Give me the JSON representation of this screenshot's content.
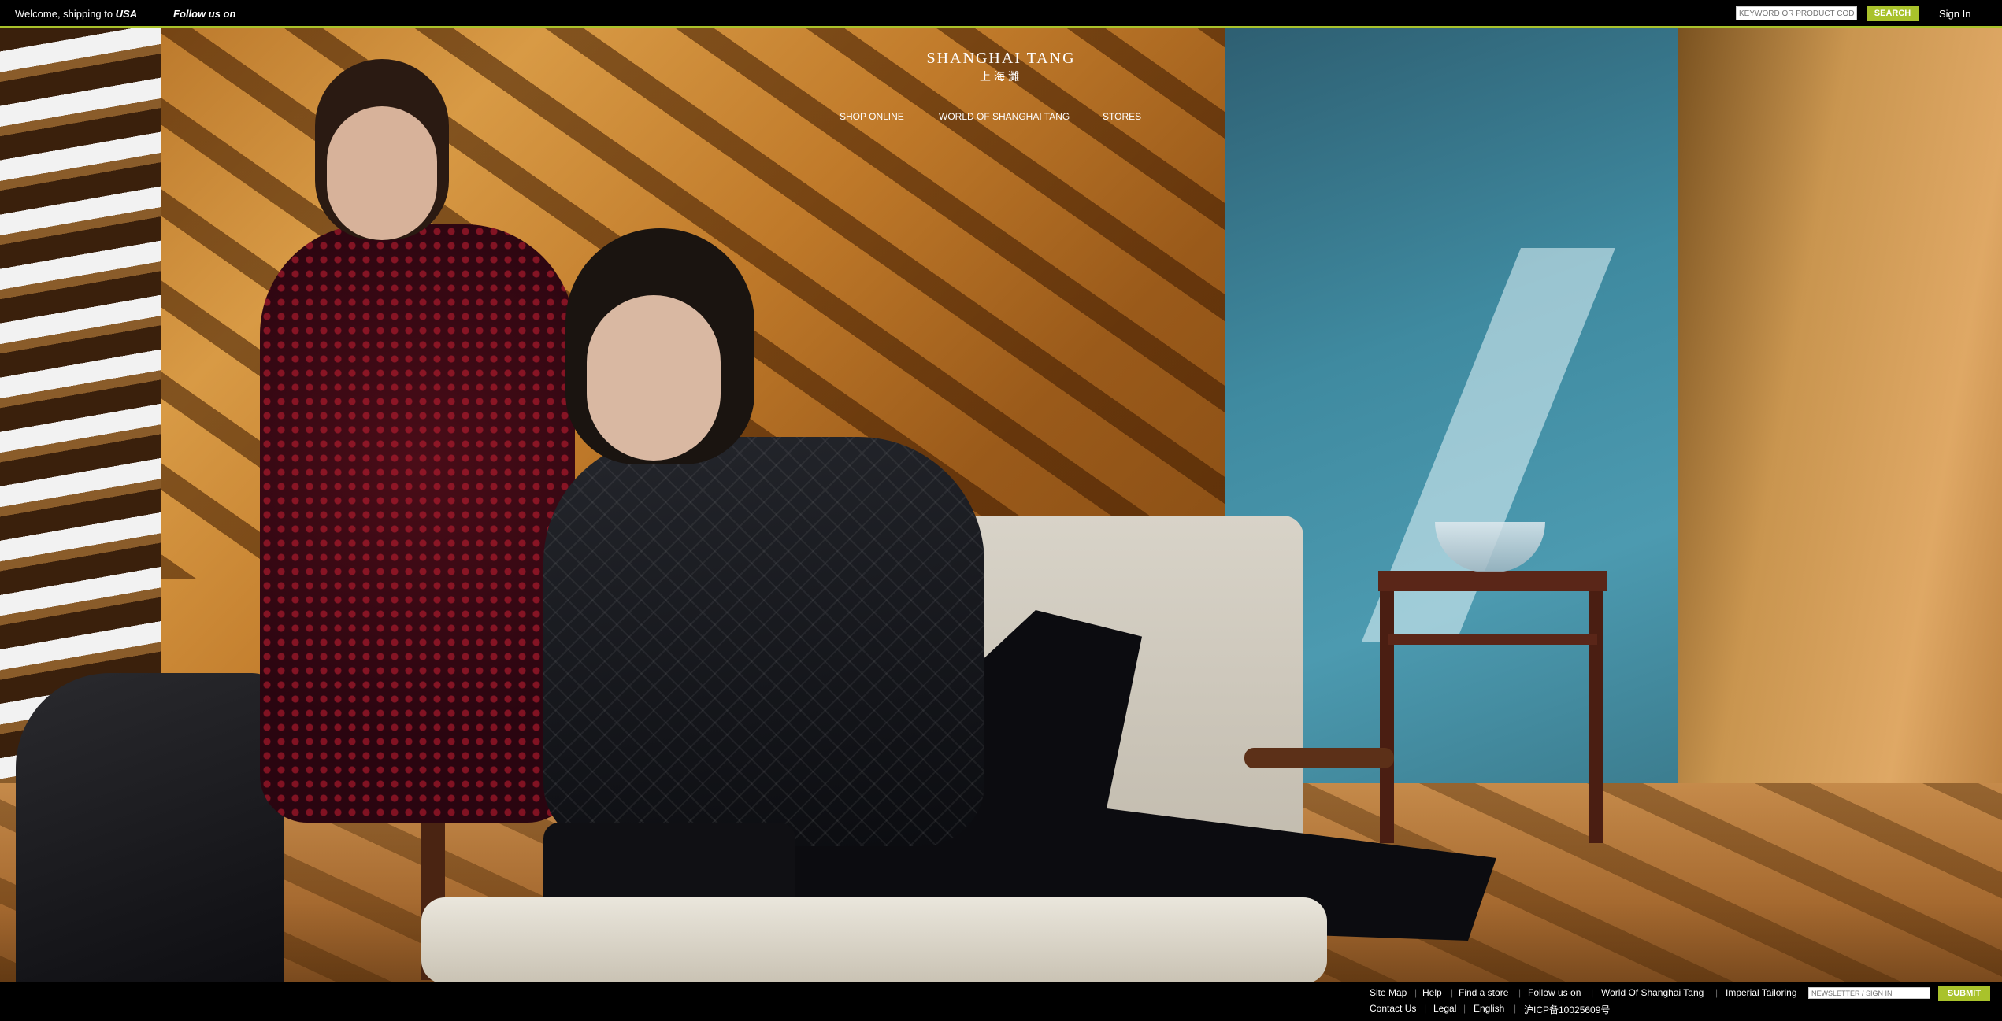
{
  "topbar": {
    "welcome_prefix": "Welcome, shipping to",
    "welcome_country": "USA",
    "follow_label": "Follow us on",
    "search_placeholder": "KEYWORD OR PRODUCT CODE",
    "search_button": "SEARCH",
    "sign_in": "Sign In"
  },
  "brand": {
    "name_en": "SHANGHAI TANG",
    "name_cn": "上海灘",
    "accent_color": "#a9c22b"
  },
  "nav": {
    "items": [
      "SHOP ONLINE",
      "WORLD OF SHANGHAI TANG",
      "STORES"
    ]
  },
  "footer": {
    "row1": [
      "Site Map",
      "Help",
      "Find a store",
      "Follow us on",
      "World Of Shanghai Tang",
      "Imperial Tailoring"
    ],
    "newsletter_placeholder": "NEWSLETTER / SIGN IN",
    "submit": "SUBMIT",
    "row2": [
      "Contact Us",
      "Legal",
      "English",
      "沪ICP备10025609号"
    ]
  }
}
